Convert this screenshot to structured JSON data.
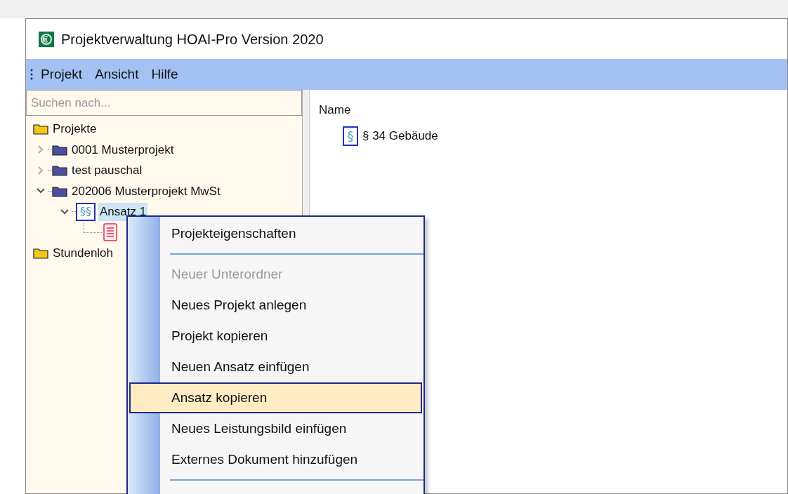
{
  "window": {
    "title": "Projektverwaltung HOAI-Pro Version 2020"
  },
  "menubar": [
    {
      "label": "Projekt"
    },
    {
      "label": "Ansicht"
    },
    {
      "label": "Hilfe"
    }
  ],
  "search": {
    "placeholder": "Suchen nach..."
  },
  "tree": [
    {
      "label": "Projekte",
      "kind": "root",
      "selected": false,
      "children": [
        {
          "label": "0001 Musterprojekt",
          "kind": "project",
          "expanded": false,
          "selected": false
        },
        {
          "label": "test pauschal",
          "kind": "project",
          "expanded": false,
          "selected": false
        },
        {
          "label": "202006 Musterprojekt MwSt",
          "kind": "project",
          "expanded": true,
          "selected": false,
          "children": [
            {
              "label": "Ansatz 1",
              "kind": "ansatz",
              "icon": "§§",
              "expanded": true,
              "selected": true,
              "children": [
                {
                  "kind": "document"
                }
              ]
            }
          ]
        }
      ]
    },
    {
      "label": "Stundenloh",
      "kind": "root",
      "selected": false
    }
  ],
  "list": {
    "column": "Name",
    "items": [
      {
        "icon": "§",
        "label": "§ 34 Gebäude"
      }
    ]
  },
  "context_menu": [
    {
      "kind": "item",
      "label": "Projekteigenschaften",
      "disabled": false,
      "selected": false
    },
    {
      "kind": "separator"
    },
    {
      "kind": "item",
      "label": "Neuer Unterordner",
      "disabled": true,
      "selected": false
    },
    {
      "kind": "item",
      "label": "Neues Projekt anlegen",
      "disabled": false,
      "selected": false
    },
    {
      "kind": "item",
      "label": "Projekt kopieren",
      "disabled": false,
      "selected": false
    },
    {
      "kind": "item",
      "label": "Neuen Ansatz einfügen",
      "disabled": false,
      "selected": false
    },
    {
      "kind": "item",
      "label": "Ansatz kopieren",
      "disabled": false,
      "selected": true
    },
    {
      "kind": "item",
      "label": "Neues Leistungsbild einfügen",
      "disabled": false,
      "selected": false
    },
    {
      "kind": "item",
      "label": "Externes Dokument hinzufügen",
      "disabled": false,
      "selected": false
    },
    {
      "kind": "separator"
    }
  ]
}
